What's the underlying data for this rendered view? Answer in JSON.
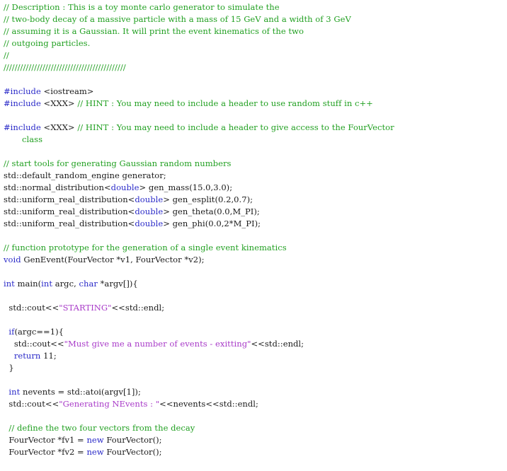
{
  "colors": {
    "comment": "#22a022",
    "keyword": "#2a2ac8",
    "string": "#a83ac8",
    "text": "#1a1a1a",
    "background": "#ffffff"
  },
  "lines": [
    [
      {
        "cls": "c",
        "text": "// Description : This is a toy monte carlo generator to simulate the"
      }
    ],
    [
      {
        "cls": "c",
        "text": "// two-body decay of a massive particle with a mass of 15 GeV and a width of 3 GeV"
      }
    ],
    [
      {
        "cls": "c",
        "text": "// assuming it is a Gaussian. It will print the event kinematics of the two"
      }
    ],
    [
      {
        "cls": "c",
        "text": "// outgoing particles."
      }
    ],
    [
      {
        "cls": "c",
        "text": "//"
      }
    ],
    [
      {
        "cls": "c",
        "text": "////////////////////////////////////////////"
      }
    ],
    [],
    [
      {
        "cls": "p",
        "text": "#include "
      },
      {
        "cls": "t",
        "text": "<iostream>"
      }
    ],
    [
      {
        "cls": "p",
        "text": "#include "
      },
      {
        "cls": "t",
        "text": "<XXX> "
      },
      {
        "cls": "c",
        "text": "// HINT : You may need to include a header to use random stuff in c++"
      }
    ],
    [],
    [
      {
        "cls": "p",
        "text": "#include "
      },
      {
        "cls": "t",
        "text": "<XXX> "
      },
      {
        "cls": "c",
        "text": "// HINT : You may need to include a header to give access to the FourVector"
      }
    ],
    [
      {
        "cls": "c",
        "text": "class",
        "wrap": true
      }
    ],
    [],
    [
      {
        "cls": "c",
        "text": "// start tools for generating Gaussian random numbers"
      }
    ],
    [
      {
        "cls": "t",
        "text": "std::default_random_engine generator;"
      }
    ],
    [
      {
        "cls": "t",
        "text": "std::normal_distribution<"
      },
      {
        "cls": "k",
        "text": "double"
      },
      {
        "cls": "t",
        "text": "> gen_mass(15.0,3.0);"
      }
    ],
    [
      {
        "cls": "t",
        "text": "std::uniform_real_distribution<"
      },
      {
        "cls": "k",
        "text": "double"
      },
      {
        "cls": "t",
        "text": "> gen_esplit(0.2,0.7);"
      }
    ],
    [
      {
        "cls": "t",
        "text": "std::uniform_real_distribution<"
      },
      {
        "cls": "k",
        "text": "double"
      },
      {
        "cls": "t",
        "text": "> gen_theta(0.0,M_PI);"
      }
    ],
    [
      {
        "cls": "t",
        "text": "std::uniform_real_distribution<"
      },
      {
        "cls": "k",
        "text": "double"
      },
      {
        "cls": "t",
        "text": "> gen_phi(0.0,2*M_PI);"
      }
    ],
    [],
    [
      {
        "cls": "c",
        "text": "// function prototype for the generation of a single event kinematics"
      }
    ],
    [
      {
        "cls": "k",
        "text": "void"
      },
      {
        "cls": "t",
        "text": " GenEvent(FourVector *v1, FourVector *v2);"
      }
    ],
    [],
    [
      {
        "cls": "k",
        "text": "int"
      },
      {
        "cls": "t",
        "text": " main("
      },
      {
        "cls": "k",
        "text": "int"
      },
      {
        "cls": "t",
        "text": " argc, "
      },
      {
        "cls": "k",
        "text": "char"
      },
      {
        "cls": "t",
        "text": " *argv[]){"
      }
    ],
    [],
    [
      {
        "cls": "t",
        "text": "  std::cout<<"
      },
      {
        "cls": "s",
        "text": "\"STARTING\""
      },
      {
        "cls": "t",
        "text": "<<std::endl;"
      }
    ],
    [],
    [
      {
        "cls": "t",
        "text": "  "
      },
      {
        "cls": "k",
        "text": "if"
      },
      {
        "cls": "t",
        "text": "(argc==1){"
      }
    ],
    [
      {
        "cls": "t",
        "text": "    std::cout<<"
      },
      {
        "cls": "s",
        "text": "\"Must give me a number of events - exitting\""
      },
      {
        "cls": "t",
        "text": "<<std::endl;"
      }
    ],
    [
      {
        "cls": "t",
        "text": "    "
      },
      {
        "cls": "k",
        "text": "return"
      },
      {
        "cls": "t",
        "text": " 11;"
      }
    ],
    [
      {
        "cls": "t",
        "text": "  }"
      }
    ],
    [],
    [
      {
        "cls": "t",
        "text": "  "
      },
      {
        "cls": "k",
        "text": "int"
      },
      {
        "cls": "t",
        "text": " nevents = std::atoi(argv[1]);"
      }
    ],
    [
      {
        "cls": "t",
        "text": "  std::cout<<"
      },
      {
        "cls": "s",
        "text": "\"Generating NEvents : \""
      },
      {
        "cls": "t",
        "text": "<<nevents<<std::endl;"
      }
    ],
    [],
    [
      {
        "cls": "c",
        "text": "  // define the two four vectors from the decay"
      }
    ],
    [
      {
        "cls": "t",
        "text": "  FourVector *fv1 = "
      },
      {
        "cls": "k",
        "text": "new"
      },
      {
        "cls": "t",
        "text": " FourVector();"
      }
    ],
    [
      {
        "cls": "t",
        "text": "  FourVector *fv2 = "
      },
      {
        "cls": "k",
        "text": "new"
      },
      {
        "cls": "t",
        "text": " FourVector();"
      }
    ]
  ]
}
